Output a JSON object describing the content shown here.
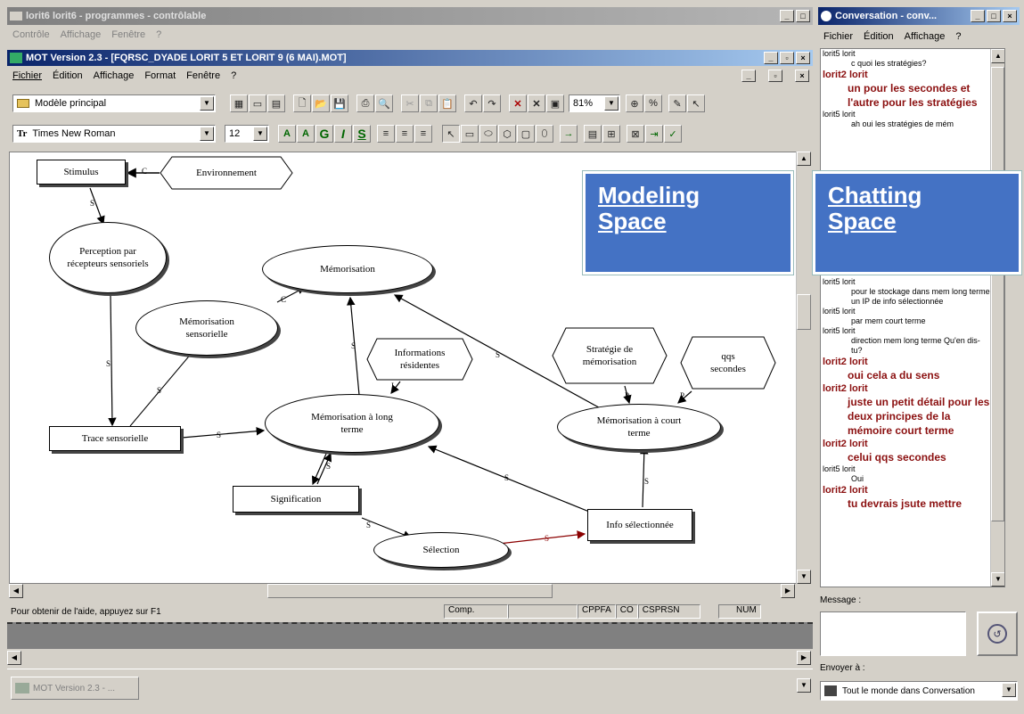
{
  "outer_window": {
    "title": "lorit6 lorit6 - programmes - contrôlable",
    "menu": [
      "Contrôle",
      "Affichage",
      "Fenêtre",
      "?"
    ]
  },
  "mot_window": {
    "title": "MOT Version 2.3 - [FQRSC_DYADE LORIT 5 ET LORIT 9 (6 MAI).MOT]",
    "menu": [
      "Fichier",
      "Édition",
      "Affichage",
      "Format",
      "Fenêtre",
      "?"
    ],
    "model_combo": "Modèle principal",
    "font_combo": "Times New Roman",
    "size_combo": "12",
    "zoom_combo": "81%",
    "format_buttons": [
      "A",
      "A",
      "G",
      "I",
      "S"
    ]
  },
  "diagram": {
    "nodes": {
      "stimulus": "Stimulus",
      "environnement": "Environnement",
      "perception": "Perception par récepteurs sensoriels",
      "memorisation": "Mémorisation",
      "mem_sensorielle": "Mémorisation sensorielle",
      "informations": "Informations résidentes",
      "strategie": "Stratégie de mémorisation",
      "qqs": "qqs secondes",
      "trace": "Trace sensorielle",
      "mem_long": "Mémorisation à long terme",
      "mem_court": "Mémorisation à court terme",
      "signification": "Signification",
      "selection": "Sélection",
      "info_sel": "Info sélectionnée"
    },
    "link_labels": {
      "c": "C",
      "p": "P",
      "s": "S",
      "i": "I"
    }
  },
  "overlays": {
    "modeling": "Modeling Space",
    "chatting": "Chatting Space"
  },
  "status_bar": {
    "help": "Pour obtenir de l'aide, appuyez sur F1",
    "comp": "Comp.",
    "cppfa": "CPPFA",
    "co": "CO",
    "csprsn": "CSPRSN",
    "num": "NUM"
  },
  "taskbar": {
    "item": "MOT Version 2.3 - ..."
  },
  "chat_window": {
    "title": "Conversation - conv...",
    "menu": [
      "Fichier",
      "Édition",
      "Affichage",
      "?"
    ],
    "messages_top": [
      {
        "user": "lorit5 lorit",
        "text": "c quoi les stratégies?",
        "bold": false
      },
      {
        "user": "lorit2 lorit",
        "text": "un pour les secondes et l'autre pour les stratégies",
        "bold": true
      },
      {
        "user": "lorit5 lorit",
        "text": "ah oui les stratégies de mém",
        "bold": false
      }
    ],
    "messages_bottom": [
      {
        "user": "lorit5 lorit",
        "text": "pour le stockage dans mem long terme un IP de info sélectionnée",
        "bold": false
      },
      {
        "user": "lorit5 lorit",
        "text": "par mem court terme",
        "bold": false
      },
      {
        "user": "lorit5 lorit",
        "text": "direction mem long terme Qu'en dis-tu?",
        "bold": false
      },
      {
        "user": "lorit2 lorit",
        "text": "oui cela a du sens",
        "bold": true
      },
      {
        "user": "lorit2 lorit",
        "text": "juste un petit détail pour les deux principes de la mémoire court terme",
        "bold": true
      },
      {
        "user": "lorit2 lorit",
        "text": "celui qqs secondes",
        "bold": true
      },
      {
        "user": "lorit5 lorit",
        "text": "Oui",
        "bold": false
      },
      {
        "user": "lorit2 lorit",
        "text": "tu devrais jsute mettre",
        "bold": true
      }
    ],
    "message_label": "Message :",
    "send_to_label": "Envoyer à :",
    "send_to_value": "Tout le monde dans Conversation"
  }
}
